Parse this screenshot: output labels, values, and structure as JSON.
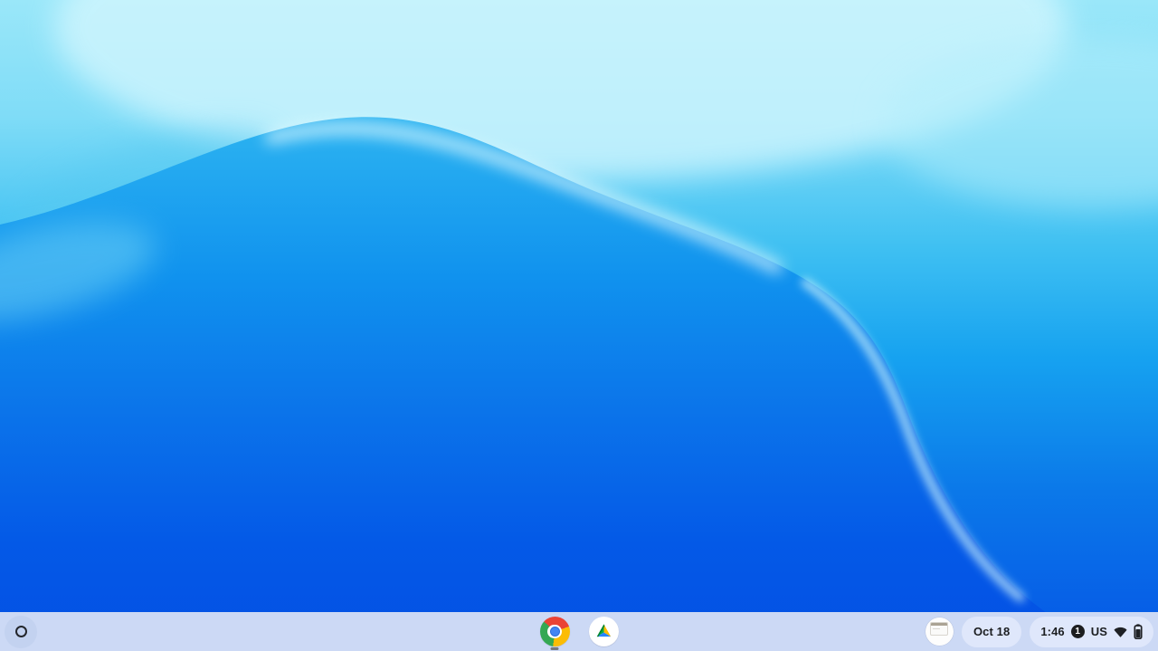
{
  "wallpaper": {
    "description": "ChromeOS default blue wave wallpaper",
    "colors": {
      "sky_top": "#9ae7f9",
      "sky_highlight": "#d5f7fe",
      "wave_mid": "#1092ee",
      "wave_bottom": "#0350e4",
      "wave_edge_highlight": "#e2fafe"
    }
  },
  "shelf": {
    "background": "#ccd9f5",
    "pill_background": "#dfe7fb",
    "launcher": {
      "icon": "launcher-ring"
    },
    "apps": [
      {
        "name": "Google Chrome",
        "icon": "chrome-logo",
        "running": true
      },
      {
        "name": "Google Drive",
        "icon": "drive-logo",
        "running": false
      }
    ],
    "tray": {
      "notification_thumbnail": "screen-capture-preview",
      "date": "Oct 18",
      "time": "1:46",
      "notification_count": "1",
      "keyboard_layout": "US",
      "icons": {
        "wifi": "wifi-full-signal",
        "battery": "battery-mostly-charged"
      }
    }
  }
}
